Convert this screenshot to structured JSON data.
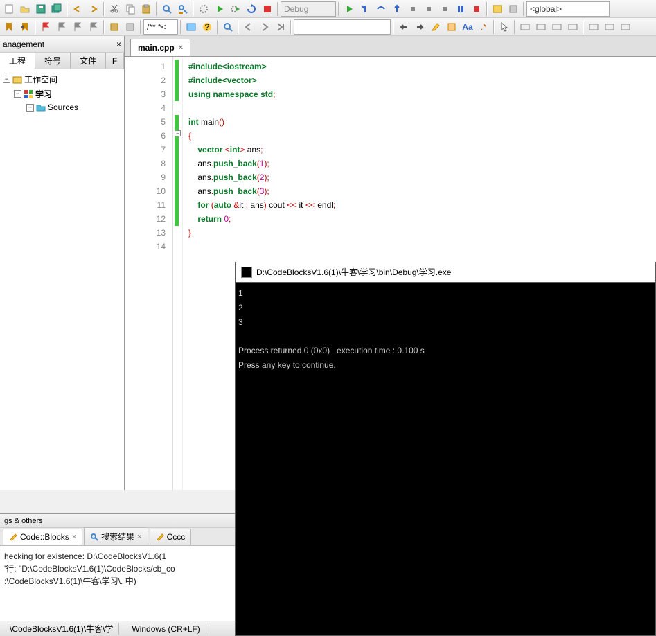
{
  "toolbar": {
    "build_config": "Debug",
    "scope": "<global>",
    "search_text": "/** *<"
  },
  "sidebar": {
    "panel_title": "anagement",
    "close_x": "×",
    "tabs": [
      "工程",
      "符号",
      "文件",
      "F"
    ],
    "tree": {
      "workspace": "工作空间",
      "project": "学习",
      "sources": "Sources"
    }
  },
  "editor": {
    "tab_label": "main.cpp",
    "lines": {
      "count": 14
    }
  },
  "code_tokens": {
    "l1": {
      "include": "#include",
      "hdr": "<iostream>"
    },
    "l2": {
      "include": "#include",
      "hdr": "<vector>"
    },
    "l3": {
      "using": "using",
      "namespace": "namespace",
      "std": "std"
    },
    "l5": {
      "int": "int",
      "main": "main"
    },
    "l7": {
      "vector": "vector",
      "int": "int",
      "ans": " ans"
    },
    "l8": {
      "ans": "ans",
      "push": "push_back",
      "n": "1"
    },
    "l9": {
      "ans": "ans",
      "push": "push_back",
      "n": "2"
    },
    "l10": {
      "ans": "ans",
      "push": "push_back",
      "n": "3"
    },
    "l11": {
      "for": "for",
      "auto": "auto",
      "it": "it",
      "ans": "ans",
      "cout": "cout",
      "endl": "endl"
    },
    "l12": {
      "return": "return",
      "n": "0"
    }
  },
  "console": {
    "title": "D:\\CodeBlocksV1.6(1)\\牛客\\学习\\bin\\Debug\\学习.exe",
    "out1": "1",
    "out2": "2",
    "out3": "3",
    "msg1": "Process returned 0 (0x0)   execution time : 0.100 s",
    "msg2": "Press any key to continue."
  },
  "bottom": {
    "title": "gs & others",
    "tabs": {
      "t1": "Code::Blocks",
      "t2": "搜索结果",
      "t3": "Cccc"
    },
    "log1": "hecking for existence: D:\\CodeBlocksV1.6(1",
    "log2": "'行: \"D:\\CodeBlocksV1.6(1)\\CodeBlocks/cb_co",
    "log3": ":\\CodeBlocksV1.6(1)\\牛客\\学习\\. 中)"
  },
  "status": {
    "path": "\\CodeBlocksV1.6(1)\\牛客\\学",
    "encoding": "Windows (CR+LF)"
  }
}
